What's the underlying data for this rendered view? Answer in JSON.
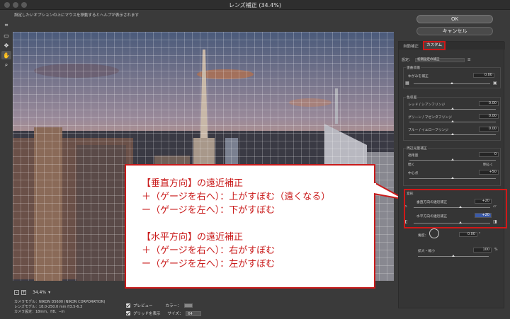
{
  "window": {
    "title": "レンズ補正 (34.4%)"
  },
  "hint": "設定したいオプションの上にマウスを移動するとヘルプが表示されます",
  "buttons": {
    "ok": "OK",
    "cancel": "キャンセル"
  },
  "tabs": {
    "auto": "自動補正",
    "custom": "カスタム"
  },
  "settings": {
    "label": "設定：",
    "value": "初期設定の補正"
  },
  "groups": {
    "distortion": {
      "title": "歪曲収差",
      "row_label": "ゆがみを補正",
      "value": "0.00"
    },
    "chromatic": {
      "title": "色収差",
      "rows": [
        {
          "label": "レッド / シアンフリンジ",
          "value": "0.00"
        },
        {
          "label": "グリーン / マゼンタフリンジ",
          "value": "0.00"
        },
        {
          "label": "ブルー / イエローフリンジ",
          "value": "0.00"
        }
      ]
    },
    "vignette": {
      "title": "周辺光量補正",
      "amount_label": "適用量",
      "amount_value": "0",
      "dark_label": "暗く",
      "light_label": "明るく",
      "midpoint_label": "中心点",
      "midpoint_value": "+50"
    },
    "transform": {
      "title": "変形",
      "vertical_label": "垂直方向の遠近補正",
      "vertical_value": "+20",
      "horizontal_label": "水平方向の遠近補正",
      "horizontal_value": "+20",
      "angle_label": "角度：",
      "angle_value": "0.00",
      "angle_unit": "°",
      "scale_label": "拡大・縮小",
      "scale_value": "100",
      "scale_unit": "%"
    }
  },
  "zoom": {
    "minus": "-",
    "plus": "+",
    "value": "34.4%"
  },
  "camera_info": [
    "カメラモデル：NIKON D5600 (NIKON CORPORATION)",
    "レンズモデル：18.0-250.0 mm f/3.5-6.3",
    "カメラ設定：18mm、f/8、--m"
  ],
  "options": {
    "preview": "プレビュー",
    "show_grid": "グリッドを表示",
    "color_label": "カラー：",
    "size_label": "サイズ：",
    "size_value": "64"
  },
  "callout": {
    "line1": "【垂直方向】の遠近補正",
    "line2": "＋（ゲージを右へ）：上がすぼむ（遠くなる）",
    "line3": "ー（ゲージを左へ）：下がすぼむ",
    "line4": "【水平方向】の遠近補正",
    "line5": "＋（ゲージを右へ）：右がすぼむ",
    "line6": "ー（ゲージを左へ）：左がすぼむ"
  },
  "colors": {
    "highlight_red": "#d01818",
    "callout_text": "#c91a1a"
  }
}
